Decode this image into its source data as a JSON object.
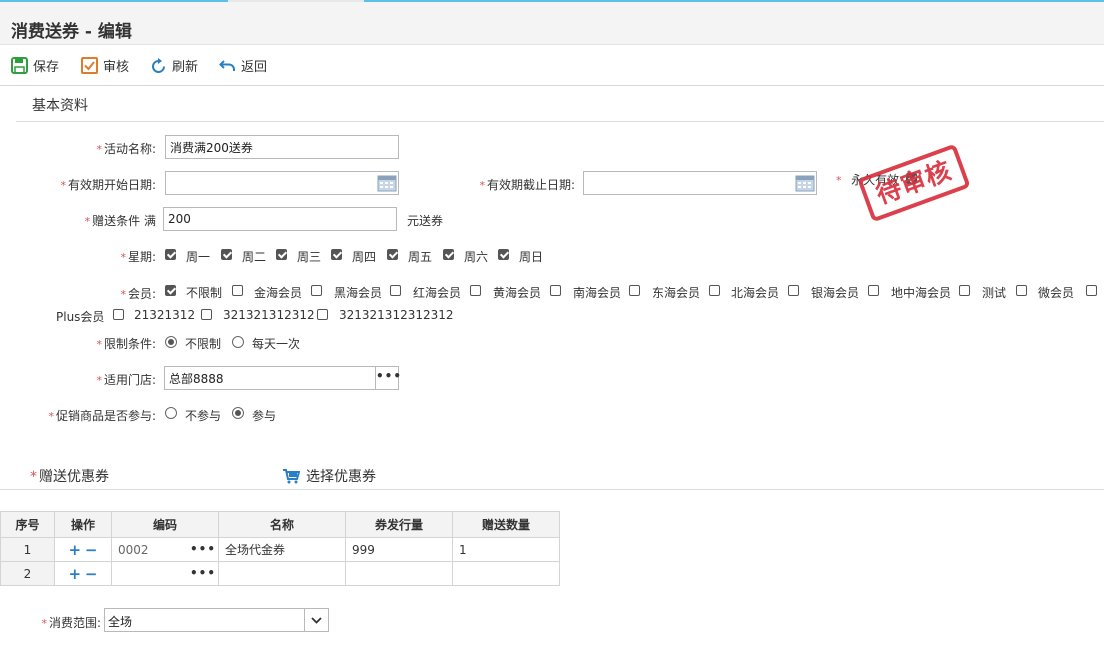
{
  "page": {
    "title": "消费送券 - 编辑"
  },
  "toolbar": {
    "save": "保存",
    "audit": "审核",
    "refresh": "刷新",
    "back": "返回"
  },
  "section_basic": "基本资料",
  "form": {
    "activity_name": {
      "label": "活动名称:",
      "value": "消费满200送券"
    },
    "start_date": {
      "label": "有效期开始日期:",
      "value": ""
    },
    "end_date": {
      "label": "有效期截止日期:",
      "value": ""
    },
    "permanent": {
      "label": "永久有效",
      "checked": true
    },
    "condition": {
      "label": "赠送条件 满",
      "value": "200",
      "suffix": "元送券"
    },
    "weekday": {
      "label": "星期:",
      "options": [
        {
          "label": "周一",
          "checked": true
        },
        {
          "label": "周二",
          "checked": true
        },
        {
          "label": "周三",
          "checked": true
        },
        {
          "label": "周四",
          "checked": true
        },
        {
          "label": "周五",
          "checked": true
        },
        {
          "label": "周六",
          "checked": true
        },
        {
          "label": "周日",
          "checked": true
        }
      ]
    },
    "member": {
      "label": "会员:",
      "options": [
        {
          "label": "不限制",
          "checked": true
        },
        {
          "label": "金海会员",
          "checked": false
        },
        {
          "label": "黑海会员",
          "checked": false
        },
        {
          "label": "红海会员",
          "checked": false
        },
        {
          "label": "黄海会员",
          "checked": false
        },
        {
          "label": "南海会员",
          "checked": false
        },
        {
          "label": "东海会员",
          "checked": false
        },
        {
          "label": "北海会员",
          "checked": false
        },
        {
          "label": "银海会员",
          "checked": false
        },
        {
          "label": "地中海会员",
          "checked": false
        },
        {
          "label": "测试",
          "checked": false
        },
        {
          "label": "微会员",
          "checked": false
        },
        {
          "label": "Plus会员",
          "checked": false
        },
        {
          "label": "21321312",
          "checked": false
        },
        {
          "label": "321321312312",
          "checked": false
        },
        {
          "label": "321321312312312",
          "checked": false
        }
      ]
    },
    "limit": {
      "label": "限制条件:",
      "options": [
        {
          "label": "不限制",
          "selected": true
        },
        {
          "label": "每天一次",
          "selected": false
        }
      ]
    },
    "store": {
      "label": "适用门店:",
      "value": "总部8888"
    },
    "promo": {
      "label": "促销商品是否参与:",
      "options": [
        {
          "label": "不参与",
          "selected": false
        },
        {
          "label": "参与",
          "selected": true
        }
      ]
    }
  },
  "stamp": "待审核",
  "section_coupon": {
    "title": "赠送优惠券",
    "select_button": "选择优惠券"
  },
  "grid": {
    "headers": [
      "序号",
      "操作",
      "编码",
      "名称",
      "券发行量",
      "赠送数量"
    ],
    "rows": [
      {
        "no": "1",
        "code": "0002",
        "name": "全场代金券",
        "issued": "999",
        "qty": "1"
      },
      {
        "no": "2",
        "code": "",
        "name": "",
        "issued": "",
        "qty": ""
      }
    ]
  },
  "scope": {
    "label": "消费范围:",
    "value": "全场"
  },
  "colors": {
    "accent": "#2a7fc4",
    "required": "#d9534f",
    "stamp": "#d9303d",
    "save_icon": "#2e9e3e",
    "audit_icon": "#e07b28"
  }
}
